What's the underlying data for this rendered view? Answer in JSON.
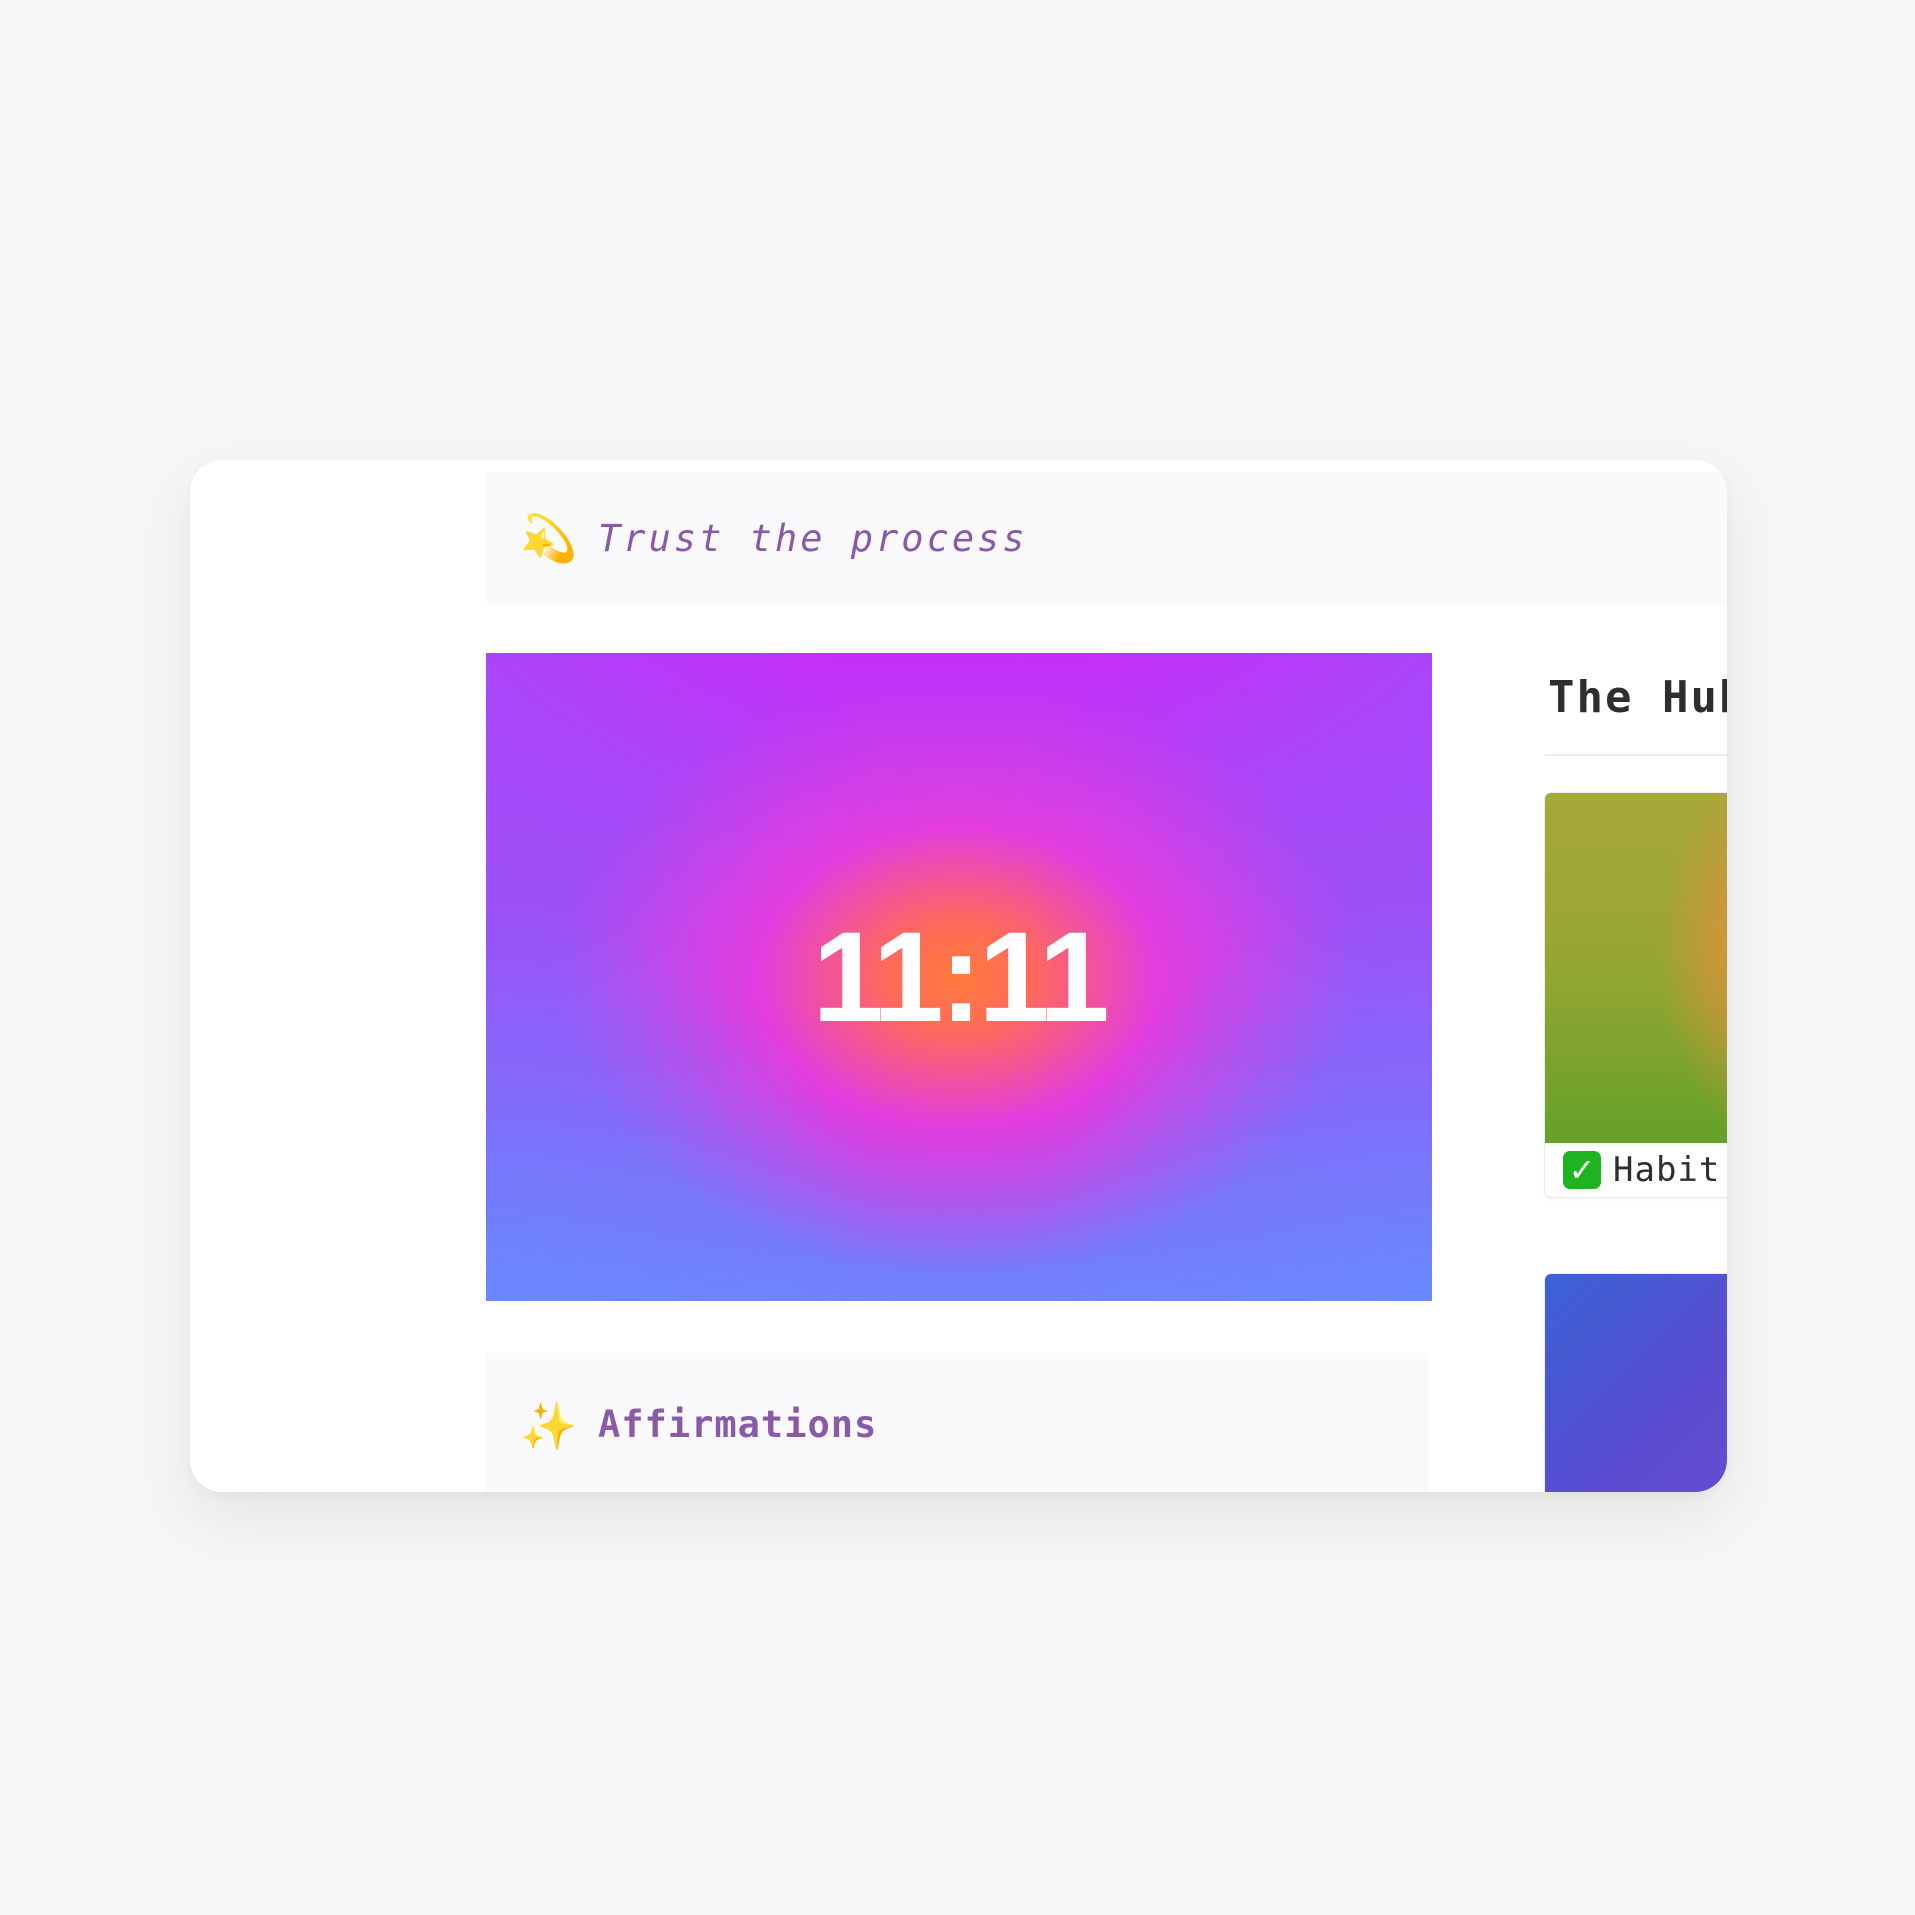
{
  "quote_callout": {
    "icon": "dizzy-star-emoji",
    "icon_glyph": "💫",
    "text": "Trust the process"
  },
  "clock_image": {
    "time": "11:11"
  },
  "affirmations_callout": {
    "icon": "sparkles-emoji",
    "icon_glyph": "✨",
    "text": "Affirmations"
  },
  "sidebar": {
    "heading": "The Hub",
    "cards": [
      {
        "icon": "check-mark-button-emoji",
        "icon_glyph": "✓",
        "label": "Habit"
      },
      {
        "label": ""
      }
    ]
  }
}
